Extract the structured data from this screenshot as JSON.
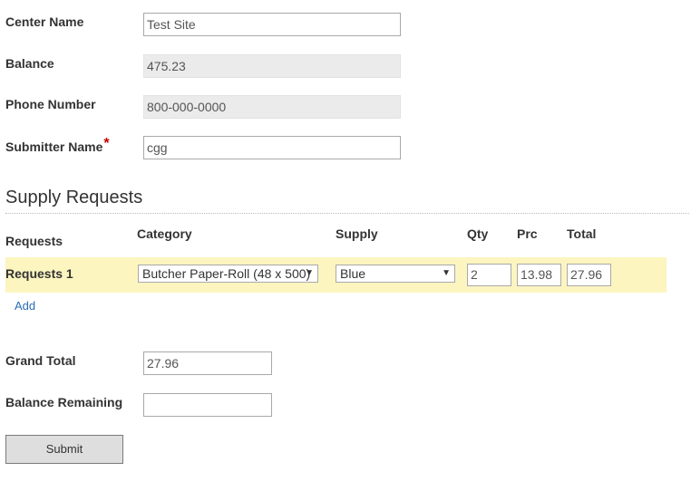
{
  "form": {
    "center_name": {
      "label": "Center Name",
      "value": "Test Site"
    },
    "balance": {
      "label": "Balance",
      "value": "475.23"
    },
    "phone_number": {
      "label": "Phone Number",
      "value": "800-000-0000"
    },
    "submitter_name": {
      "label": "Submitter Name",
      "required_mark": "*",
      "value": "cgg"
    }
  },
  "supply_requests": {
    "title": "Supply Requests",
    "headers": {
      "requests": "Requests",
      "category": "Category",
      "supply": "Supply",
      "qty": "Qty",
      "prc": "Prc",
      "total": "Total"
    },
    "rows": [
      {
        "label": "Requests 1",
        "category": "Butcher Paper-Roll (48 x 500)",
        "supply": "Blue",
        "qty": "2",
        "prc": "13.98",
        "total": "27.96"
      }
    ],
    "add_label": "Add"
  },
  "totals": {
    "grand_total": {
      "label": "Grand Total",
      "value": "27.96"
    },
    "balance_remaining": {
      "label": "Balance Remaining",
      "value": ""
    }
  },
  "submit_label": "Submit",
  "colors": {
    "highlight_row": "#fcf5c0",
    "link": "#2a6db5",
    "required": "#c00000"
  }
}
